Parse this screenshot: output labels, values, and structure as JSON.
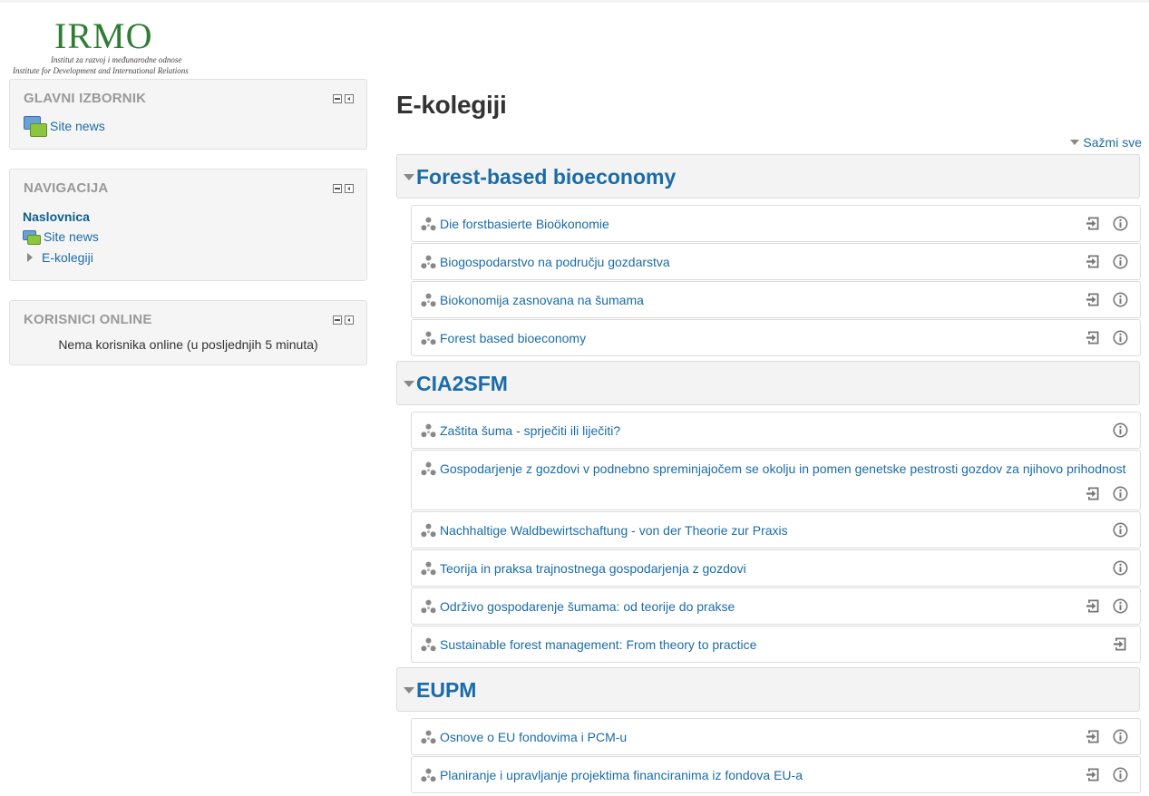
{
  "logo": {
    "word": "IRMO",
    "subtitle_hr": "Institut za razvoj i međunarodne odnose",
    "subtitle_en": "Institute for Development and International Relations"
  },
  "blocks": {
    "main_menu": {
      "title": "GLAVNI IZBORNIK",
      "link": "Site news"
    },
    "navigation": {
      "title": "NAVIGACIJA",
      "home": "Naslovnica",
      "site_news": "Site news",
      "courses": "E-kolegiji"
    },
    "online_users": {
      "title": "KORISNICI ONLINE",
      "text": "Nema korisnika online (u posljednjih 5 minuta)"
    }
  },
  "page": {
    "title": "E-kolegiji",
    "collapse_all": "Sažmi sve"
  },
  "categories": [
    {
      "name": "Forest-based bioeconomy",
      "courses": [
        {
          "name": "Die forstbasierte Bioökonomie",
          "enrol": true,
          "info": true
        },
        {
          "name": "Biogospodarstvo na području gozdarstva",
          "enrol": true,
          "info": true
        },
        {
          "name": "Biokonomija zasnovana na šumama",
          "enrol": true,
          "info": true
        },
        {
          "name": "Forest based bioeconomy",
          "enrol": true,
          "info": true
        }
      ]
    },
    {
      "name": "CIA2SFM",
      "courses": [
        {
          "name": "Zaštita šuma - sprječiti ili liječiti?",
          "enrol": false,
          "info": true
        },
        {
          "name": "Gospodarjenje z gozdovi v podnebno spreminjajočem se okolju in pomen genetske pestrosti gozdov za njihovo prihodnost",
          "enrol": true,
          "info": true
        },
        {
          "name": "Nachhaltige Waldbewirtschaftung - von der Theorie zur Praxis",
          "enrol": false,
          "info": true
        },
        {
          "name": "Teorija in praksa trajnostnega gospodarjenja z gozdovi",
          "enrol": false,
          "info": true
        },
        {
          "name": "Održivo gospodarenje šumama: od teorije do prakse",
          "enrol": true,
          "info": true
        },
        {
          "name": "Sustainable forest management: From theory to practice",
          "enrol": true,
          "info": false
        }
      ]
    },
    {
      "name": "EUPM",
      "courses": [
        {
          "name": "Osnove o EU fondovima i PCM-u",
          "enrol": true,
          "info": true
        },
        {
          "name": "Planiranje i upravljanje projektima financiranima iz fondova EU-a",
          "enrol": true,
          "info": true
        }
      ]
    }
  ]
}
